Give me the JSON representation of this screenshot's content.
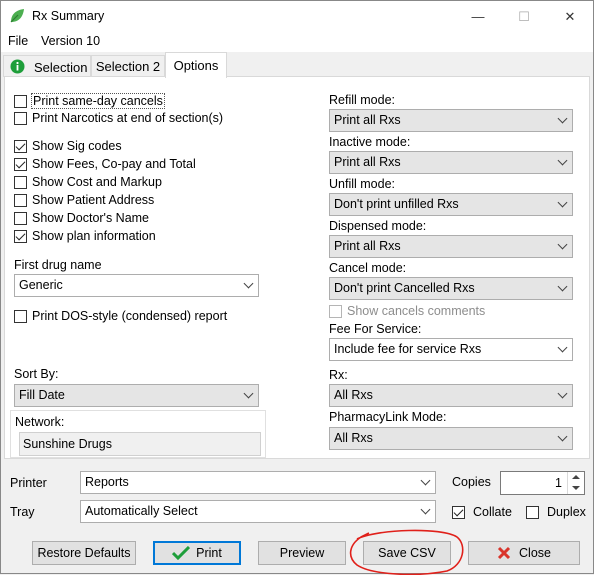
{
  "window": {
    "title": "Rx Summary",
    "minimize": "—",
    "maximize": "☐",
    "close": "✕",
    "icon": "leaf-icon",
    "icon_color": "#4caf50"
  },
  "menu": {
    "file": "File",
    "version": "Version 10"
  },
  "tabs": {
    "selection": "Selection",
    "selection2": "Selection 2",
    "options": "Options",
    "info_icon_color": "#1e9e3a"
  },
  "options": {
    "print_same_day_cancels": {
      "label": "Print same-day cancels",
      "checked": false
    },
    "print_narcotics": {
      "label": "Print Narcotics at end of section(s)",
      "checked": false
    },
    "show_sig_codes": {
      "label": "Show Sig codes",
      "checked": true
    },
    "show_fees": {
      "label": "Show Fees, Co-pay and Total",
      "checked": true
    },
    "show_cost": {
      "label": "Show Cost and Markup",
      "checked": false
    },
    "show_patient_address": {
      "label": "Show Patient Address",
      "checked": false
    },
    "show_doctor_name": {
      "label": "Show Doctor's Name",
      "checked": false
    },
    "show_plan_info": {
      "label": "Show plan information",
      "checked": true
    },
    "first_drug_name_label": "First drug name",
    "first_drug_name_value": "Generic",
    "print_dos": {
      "label": "Print DOS-style (condensed) report",
      "checked": false
    },
    "sort_by_label": "Sort By:",
    "sort_by_value": "Fill Date",
    "network_label": "Network:",
    "network_value": "Sunshine Drugs"
  },
  "modes": {
    "refill_label": "Refill mode:",
    "refill_value": "Print all Rxs",
    "inactive_label": "Inactive mode:",
    "inactive_value": "Print all Rxs",
    "unfill_label": "Unfill mode:",
    "unfill_value": "Don't print unfilled Rxs",
    "dispensed_label": "Dispensed mode:",
    "dispensed_value": "Print all Rxs",
    "cancel_label": "Cancel mode:",
    "cancel_value": "Don't print Cancelled Rxs",
    "show_cancels_comments": {
      "label": "Show cancels comments",
      "checked": false
    },
    "fee_label": "Fee For Service:",
    "fee_value": "Include fee for service Rxs",
    "rx_label": "Rx:",
    "rx_value": "All Rxs",
    "pharmacylink_label": "PharmacyLink Mode:",
    "pharmacylink_value": "All Rxs"
  },
  "print_settings": {
    "printer_label": "Printer",
    "printer_value": "Reports",
    "tray_label": "Tray",
    "tray_value": "Automatically Select",
    "copies_label": "Copies",
    "copies_value": "1",
    "collate": {
      "label": "Collate",
      "checked": true
    },
    "duplex": {
      "label": "Duplex",
      "checked": false
    }
  },
  "buttons": {
    "restore_defaults": "Restore Defaults",
    "print": "Print",
    "preview": "Preview",
    "save_csv": "Save CSV",
    "close": "Close",
    "print_icon_color": "#1e9e3a",
    "close_icon_color": "#d9342b",
    "annotation_color": "#e0201a"
  }
}
